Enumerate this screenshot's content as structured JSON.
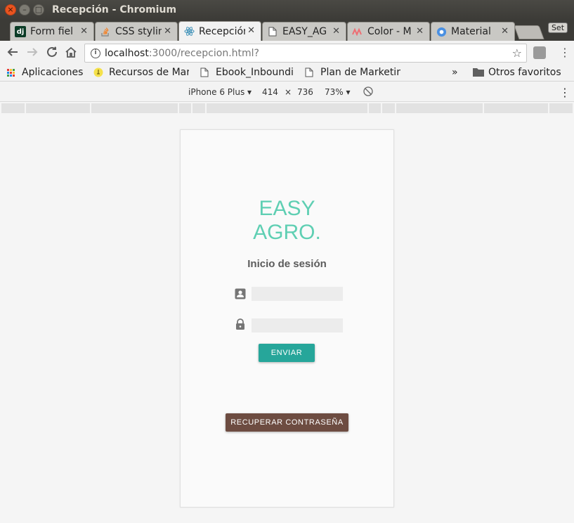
{
  "window": {
    "title": "Recepción - Chromium"
  },
  "tabs": [
    {
      "label": "Form fiel",
      "icon": "django-icon"
    },
    {
      "label": "CSS stylin",
      "icon": "stackoverflow-icon"
    },
    {
      "label": "Recepción",
      "icon": "react-icon",
      "active": true
    },
    {
      "label": "EASY_AG",
      "icon": "page-icon"
    },
    {
      "label": "Color - M",
      "icon": "materialize-icon"
    },
    {
      "label": "Material",
      "icon": "chromium-icon"
    }
  ],
  "tab_extra": {
    "set_label": "Set"
  },
  "address_bar": {
    "host": "localhost",
    "rest": ":3000/recepcion.html?"
  },
  "bookmarks": {
    "apps": "Aplicaciones",
    "items": [
      "Recursos de Mar",
      "Ebook_Inboundi",
      "Plan de Marketin"
    ],
    "overflow": "»",
    "other": "Otros favoritos"
  },
  "device_toolbar": {
    "device": "iPhone 6 Plus",
    "width": "414",
    "times": "×",
    "height": "736",
    "zoom": "73%"
  },
  "page": {
    "brand_line1": "EASY",
    "brand_line2": "AGRO.",
    "login_title": "Inicio de sesión",
    "send_label": "ENVIAR",
    "recover_label": "RECUPERAR CONTRASEÑA"
  },
  "colors": {
    "brand": "#5fcfb3",
    "send_button": "#26a69a",
    "recover_button": "#6d4c41"
  }
}
